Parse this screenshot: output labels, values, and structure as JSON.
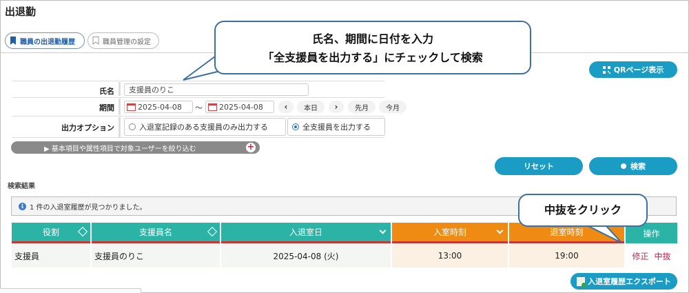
{
  "page": {
    "title": "出退勤"
  },
  "tabs": [
    {
      "label": "職員の出退勤履歴",
      "active": true
    },
    {
      "label": "職員管理の設定",
      "active": false
    }
  ],
  "callouts": {
    "instruction_line1": "氏名、期間に日付を入力",
    "instruction_line2": "「全支援員を出力する」にチェックして検索",
    "click_hint": "中抜をクリック"
  },
  "qr_button": {
    "label": "QRページ表示"
  },
  "form": {
    "name_label": "氏名",
    "name_value": "支援員のりこ",
    "period_label": "期間",
    "date_from": "2025-04-08",
    "date_to": "2025-04-08",
    "range_sep": "〜",
    "prev_glyph": "‹",
    "next_glyph": "›",
    "today_label": "本日",
    "prev_month_label": "先月",
    "this_month_label": "今月",
    "output_option_label": "出力オプション",
    "option_entries_only": "入退室記録のある支援員のみ出力する",
    "option_all_staff": "全支援員を出力する",
    "selected_option": "all_staff"
  },
  "filter_bar": {
    "label": "▶  基本項目や属性項目で対象ユーザーを絞り込む",
    "plus": "+"
  },
  "actions": {
    "reset_label": "リセット",
    "search_label": "検索"
  },
  "results": {
    "section_label": "検索結果",
    "message": "1 件の入退室履歴が見つかりました。",
    "info_glyph": "i",
    "columns": [
      "役割",
      "支援員名",
      "入退室日",
      "入室時刻",
      "退室時刻",
      "操作"
    ],
    "rows": [
      {
        "role": "支援員",
        "name": "支援員のりこ",
        "date": "2025-04-08 (火)",
        "in_time": "13:00",
        "out_time": "19:00",
        "edit": "修正",
        "break": "中抜"
      }
    ]
  },
  "export_button": {
    "label": "入退室履歴エクスポート"
  },
  "colors": {
    "accent": "#1a9cc4",
    "teal": "#2bb3a6",
    "orange": "#ef8a12",
    "link": "#c0264f",
    "callout_border": "#3b6fa0"
  }
}
